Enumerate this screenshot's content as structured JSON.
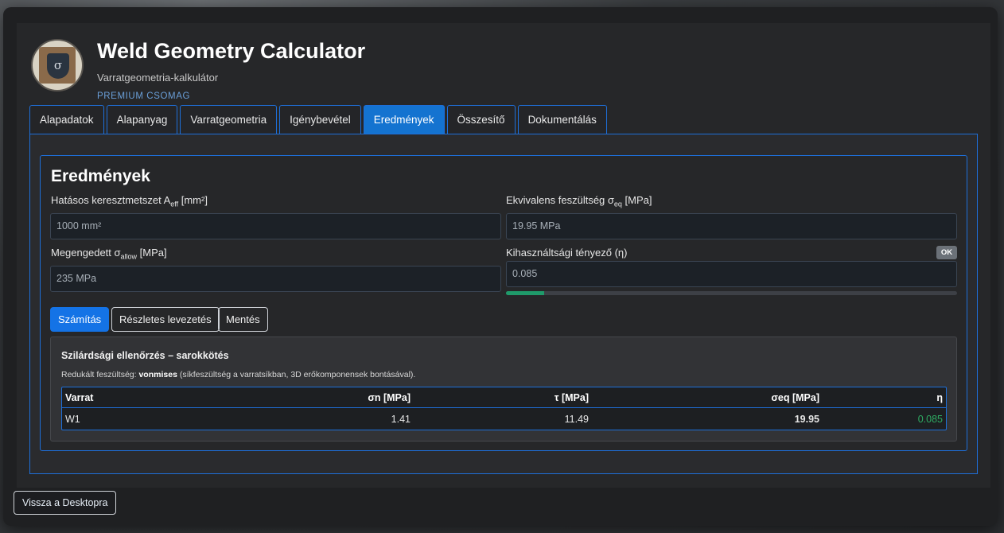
{
  "app": {
    "title": "Weld Geometry Calculator",
    "subtitle": "Varratgeometria-kalkulátor",
    "edition": "PREMIUM CSOMAG",
    "logo_symbol": "σ"
  },
  "tabs": [
    {
      "label": "Alapadatok",
      "active": false
    },
    {
      "label": "Alapanyag",
      "active": false
    },
    {
      "label": "Varratgeometria",
      "active": false
    },
    {
      "label": "Igénybevétel",
      "active": false
    },
    {
      "label": "Eredmények",
      "active": true
    },
    {
      "label": "Összesítő",
      "active": false
    },
    {
      "label": "Dokumentálás",
      "active": false
    }
  ],
  "results_card": {
    "title": "Eredmények",
    "fields": {
      "aeff": {
        "label_prefix": "Hatásos keresztmetszet A",
        "label_sub": "eff",
        "label_suffix": " [mm²]",
        "value": "1000 mm²"
      },
      "sigma_eq": {
        "label_prefix": "Ekvivalens feszültség σ",
        "label_sub": "eq",
        "label_suffix": " [MPa]",
        "value": "19.95 MPa"
      },
      "sigma_allow": {
        "label_prefix": "Megengedett σ",
        "label_sub": "allow",
        "label_suffix": " [MPa]",
        "value": "235 MPa"
      },
      "eta": {
        "label": "Kihasználtsági tényező (η)",
        "value": "0.085",
        "badge": "OK",
        "progress_fraction": 0.085
      }
    },
    "buttons": {
      "calculate": "Számítás",
      "detailed": "Részletes levezetés",
      "save": "Mentés"
    },
    "check": {
      "title": "Szilárdsági ellenőrzés – sarokkötés",
      "desc_prefix": "Redukált feszültség: ",
      "desc_method": "vonmises",
      "desc_suffix": " (síkfeszültség a varratsíkban, 3D erőkomponensek bontásával).",
      "columns": [
        "Varrat",
        "σn [MPa]",
        "τ [MPa]",
        "σeq [MPa]",
        "η"
      ],
      "rows": [
        [
          "W1",
          "1.41",
          "11.49",
          "19.95",
          "0.085"
        ]
      ]
    }
  },
  "footer": {
    "back_button": "Vissza a Desktopra"
  },
  "colors": {
    "accent": "#1473e6",
    "border_accent": "#1e6fd9",
    "ok_green": "#2eaa62"
  }
}
